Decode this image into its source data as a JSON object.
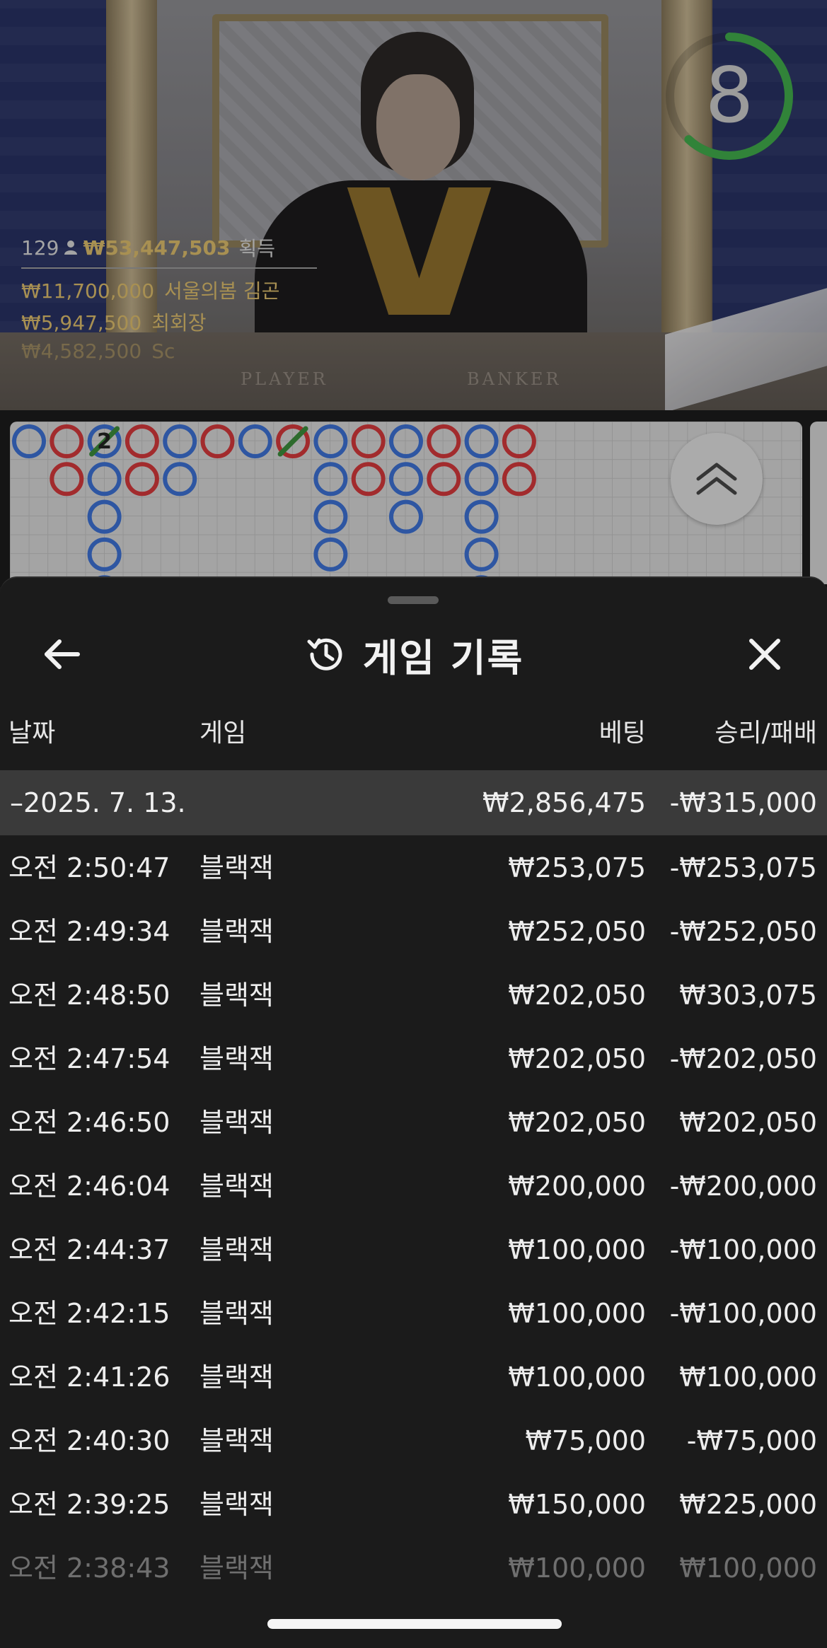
{
  "video": {
    "countdown": "8",
    "countdown_fraction": 0.62,
    "viewers": "129",
    "total_won": "₩53,447,503",
    "total_won_label": "획득",
    "winners": [
      {
        "amount": "₩11,700,000",
        "name": "서울의봄 김곤"
      },
      {
        "amount": "₩5,947,500",
        "name": "최회장"
      },
      {
        "amount": "₩4,582,500",
        "name": "Sc"
      }
    ],
    "table_labels": {
      "player": "PLAYER",
      "banker": "BANKER"
    },
    "colors": {
      "timer": "#3fa84a",
      "winner_text": "#d8b96a"
    }
  },
  "roadmap": {
    "colors": {
      "player": "#3b6fd0",
      "banker": "#d0383a",
      "tie": "#3a8a3a"
    },
    "tie_label": "2",
    "columns": [
      [
        "P"
      ],
      [
        "B",
        "B"
      ],
      [
        "P",
        "P",
        "P",
        "P",
        "P"
      ],
      [
        "B",
        "B"
      ],
      [
        "P",
        "P"
      ],
      [
        "B"
      ],
      [
        "P"
      ],
      [
        "B"
      ],
      [
        "P",
        "P",
        "P",
        "P"
      ],
      [
        "B",
        "B"
      ],
      [
        "P",
        "P",
        "P"
      ],
      [
        "B",
        "B"
      ],
      [
        "P",
        "P",
        "P",
        "P",
        "P"
      ],
      [
        "B",
        "B"
      ]
    ],
    "collapse_icon": "double-chevron-up-icon"
  },
  "sheet": {
    "title": "게임 기록",
    "title_icon": "history-icon",
    "back_icon": "arrow-left-icon",
    "close_icon": "close-icon",
    "headers": {
      "date": "날짜",
      "game": "게임",
      "bet": "베팅",
      "winloss": "승리/패배"
    },
    "summary": {
      "date": "–2025. 7. 13.",
      "bet": "₩2,856,475",
      "winloss": "-₩315,000"
    },
    "rows": [
      {
        "time": "오전 2:50:47",
        "game": "블랙잭",
        "bet": "₩253,075",
        "winloss": "-₩253,075"
      },
      {
        "time": "오전 2:49:34",
        "game": "블랙잭",
        "bet": "₩252,050",
        "winloss": "-₩252,050"
      },
      {
        "time": "오전 2:48:50",
        "game": "블랙잭",
        "bet": "₩202,050",
        "winloss": "₩303,075"
      },
      {
        "time": "오전 2:47:54",
        "game": "블랙잭",
        "bet": "₩202,050",
        "winloss": "-₩202,050"
      },
      {
        "time": "오전 2:46:50",
        "game": "블랙잭",
        "bet": "₩202,050",
        "winloss": "₩202,050"
      },
      {
        "time": "오전 2:46:04",
        "game": "블랙잭",
        "bet": "₩200,000",
        "winloss": "-₩200,000"
      },
      {
        "time": "오전 2:44:37",
        "game": "블랙잭",
        "bet": "₩100,000",
        "winloss": "-₩100,000"
      },
      {
        "time": "오전 2:42:15",
        "game": "블랙잭",
        "bet": "₩100,000",
        "winloss": "-₩100,000"
      },
      {
        "time": "오전 2:41:26",
        "game": "블랙잭",
        "bet": "₩100,000",
        "winloss": "₩100,000"
      },
      {
        "time": "오전 2:40:30",
        "game": "블랙잭",
        "bet": "₩75,000",
        "winloss": "-₩75,000"
      },
      {
        "time": "오전 2:39:25",
        "game": "블랙잭",
        "bet": "₩150,000",
        "winloss": "₩225,000"
      },
      {
        "time": "오전 2:38:43",
        "game": "블랙잭",
        "bet": "₩100,000",
        "winloss": "₩100,000"
      }
    ]
  }
}
